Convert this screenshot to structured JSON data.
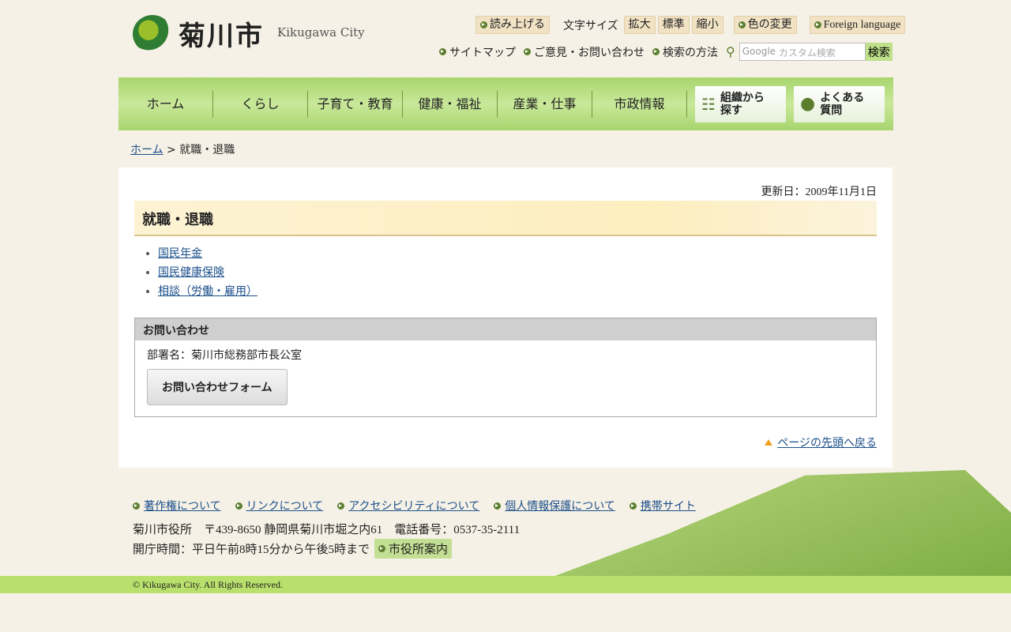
{
  "header": {
    "logo": "菊川市",
    "logo_en": "Kikugawa City",
    "util": {
      "read": "読み上げる",
      "font_size": "文字サイズ",
      "enlarge": "拡大",
      "standard": "標準",
      "shrink": "縮小",
      "color": "色の変更",
      "foreign": "Foreign language"
    },
    "links": {
      "sitemap": "サイトマップ",
      "opinion": "ご意見・お問い合わせ",
      "howto": "検索の方法"
    },
    "search": {
      "placeholder": "カスタム検索",
      "brand": "Google",
      "button": "検索"
    }
  },
  "nav": {
    "items": [
      "ホーム",
      "くらし",
      "子育て・教育",
      "健康・福祉",
      "産業・仕事",
      "市政情報"
    ],
    "org": "組織から\n探す",
    "faq": "よくある\n質問"
  },
  "breadcrumb": {
    "home": "ホーム",
    "sep": " > ",
    "current": "就職・退職"
  },
  "main": {
    "updated": "更新日：2009年11月1日",
    "title": "就職・退職",
    "links": [
      "国民年金",
      "国民健康保険",
      "相談（労働・雇用）"
    ],
    "inquiry": {
      "heading": "お問い合わせ",
      "dept": "部署名：菊川市総務部市長公室",
      "form_button": "お問い合わせフォーム"
    },
    "back_to_top": "ページの先頭へ戻る"
  },
  "footer": {
    "links": [
      "著作権について",
      "リンクについて",
      "アクセシビリティについて",
      "個人情報保護について",
      "携帯サイト"
    ],
    "address": "菊川市役所　〒439-8650 静岡県菊川市堀之内61　電話番号：0537-35-2111",
    "hours": "開庁時間：平日午前8時15分から午後5時まで",
    "guide": "市役所案内",
    "copyright": "© Kikugawa City. All Rights Reserved."
  }
}
